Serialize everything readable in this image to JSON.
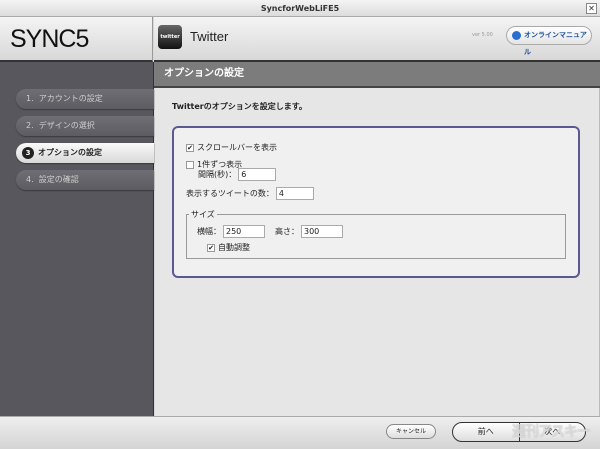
{
  "window": {
    "title": "SyncforWebLiFE5",
    "close": "✕"
  },
  "logo": "SYNC5",
  "header": {
    "app_icon_text": "twitter",
    "app_title": "Twitter",
    "version": "ver 5.00",
    "manual_button": "オンラインマニュアル"
  },
  "sidebar": {
    "steps": [
      {
        "num": "1.",
        "label": "アカウントの設定"
      },
      {
        "num": "2.",
        "label": "デザインの選択"
      },
      {
        "num": "3",
        "label": "オプションの設定"
      },
      {
        "num": "4.",
        "label": "設定の確認"
      }
    ]
  },
  "section_title": "オプションの設定",
  "content": {
    "intro": "Twitterのオプションを設定します。",
    "scrollbar": {
      "label": "スクロールバーを表示",
      "checked": true
    },
    "one_by_one": {
      "label": "1件ずつ表示",
      "checked": false
    },
    "interval": {
      "label": "間隔(秒)：",
      "value": "6"
    },
    "tweet_count": {
      "label": "表示するツイートの数：",
      "value": "4"
    },
    "size": {
      "legend": "サイズ",
      "width_label": "横幅：",
      "width_value": "250",
      "height_label": "高さ：",
      "height_value": "300",
      "auto": {
        "label": "自動調整",
        "checked": true
      }
    }
  },
  "footer": {
    "cancel": "キャンセル",
    "prev": "前へ",
    "next": "次へ",
    "watermark": "週刊アスキー"
  },
  "check_mark": "✔"
}
